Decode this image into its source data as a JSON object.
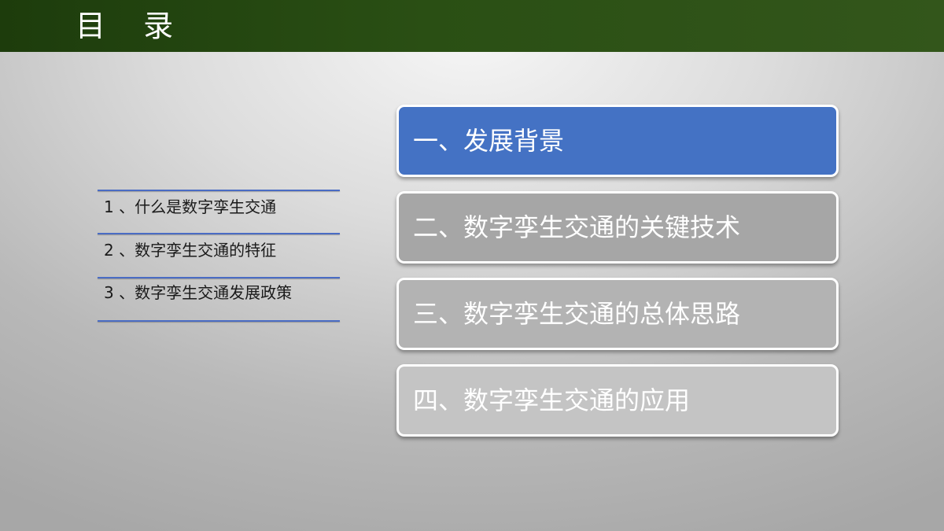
{
  "header": {
    "title": "目 录"
  },
  "sub_list": {
    "items": [
      {
        "label": "1 、什么是数字孪生交通"
      },
      {
        "label": "2 、数字孪生交通的特征"
      },
      {
        "label": "3 、数字孪生交通发展政策"
      }
    ]
  },
  "menu": {
    "items": [
      {
        "label": "一、发展背景",
        "color": "#4472c4",
        "active": true
      },
      {
        "label": "二、数字孪生交通的关键技术",
        "color": "#a6a6a6",
        "active": false
      },
      {
        "label": "三、数字孪生交通的总体思路",
        "color": "#b3b3b3",
        "active": false
      },
      {
        "label": "四、数字孪生交通的应用",
        "color": "#c4c4c4",
        "active": false
      }
    ]
  },
  "colors": {
    "header_green": "#2a4f14",
    "accent_blue": "#4472c4",
    "line_blue": "#4a6cc4"
  }
}
